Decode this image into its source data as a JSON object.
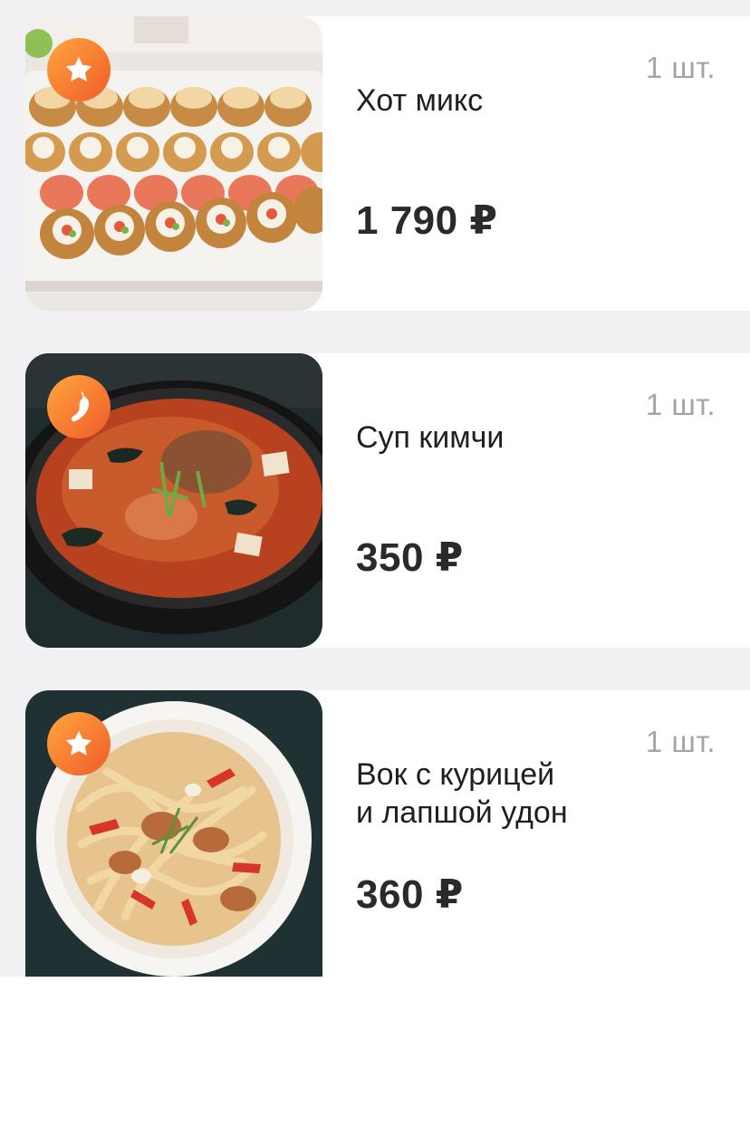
{
  "cart": {
    "items": [
      {
        "badge_icon": "star-icon",
        "quantity": "1 шт.",
        "name": "Хот микс",
        "price": "1 790 ₽"
      },
      {
        "badge_icon": "chili-pepper-icon",
        "quantity": "1 шт.",
        "name": "Суп кимчи",
        "price": "350 ₽"
      },
      {
        "badge_icon": "star-icon",
        "quantity": "1 шт.",
        "name_lines": [
          "Вок с курицей",
          "и лапшой удон"
        ],
        "price": "360 ₽"
      }
    ]
  },
  "colors": {
    "background": "#f1f1f3",
    "card": "#ffffff",
    "badge_gradient_start": "#ffa63d",
    "badge_gradient_end": "#f05b2a",
    "quantity_text": "#a4a4a8",
    "name_text": "#1f1f1f",
    "price_text": "#2a2a2a"
  }
}
